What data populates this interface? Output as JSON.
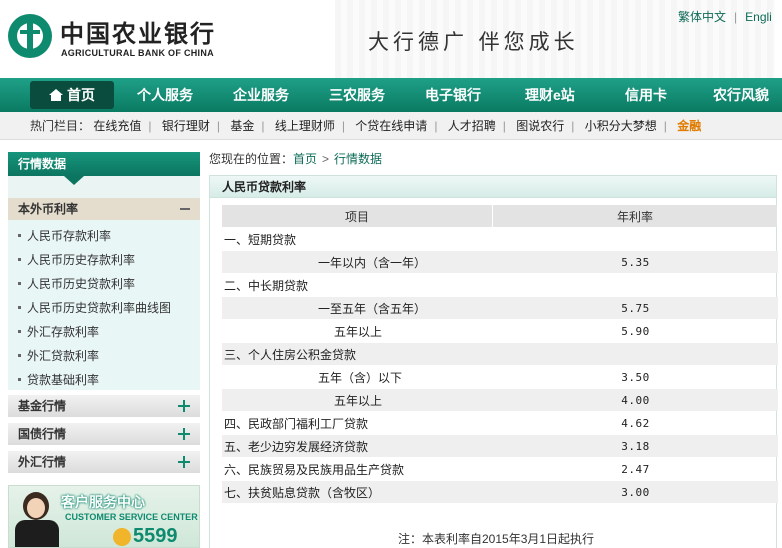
{
  "header": {
    "bank_name_cn": "中国农业银行",
    "bank_name_en": "AGRICULTURAL BANK OF CHINA",
    "slogan": "大行德广  伴您成长",
    "lang_traditional": "繁体中文",
    "lang_separator": "|",
    "lang_english": "Engli"
  },
  "nav": {
    "home": "首页",
    "items": [
      "个人服务",
      "企业服务",
      "三农服务",
      "电子银行",
      "理财e站",
      "信用卡",
      "农行风貌"
    ]
  },
  "hotbar": {
    "label": "热门栏目：",
    "links": [
      "在线充值",
      "银行理财",
      "基金",
      "线上理财师",
      "个贷在线申请",
      "人才招聘",
      "图说农行",
      "小积分大梦想"
    ],
    "highlight": "金融"
  },
  "sidebar": {
    "title": "行情数据",
    "open_category": "本外币利率",
    "items": [
      "人民币存款利率",
      "人民币历史存款利率",
      "人民币历史贷款利率",
      "人民币历史贷款利率曲线图",
      "外汇存款利率",
      "外汇贷款利率",
      "贷款基础利率"
    ],
    "categories": [
      "基金行情",
      "国债行情",
      "外汇行情"
    ],
    "banner": {
      "title": "客户服务中心",
      "subtitle": "CUSTOMER SERVICE CENTER",
      "number": "5599"
    }
  },
  "breadcrumb": {
    "prefix": "您现在的位置：",
    "home": "首页",
    "current": "行情数据"
  },
  "panel": {
    "title": "人民币贷款利率",
    "columns": [
      "项目",
      "年利率"
    ],
    "rows": [
      {
        "item": "一、短期贷款",
        "rate": ""
      },
      {
        "item": "一年以内（含一年）",
        "rate": "5.35"
      },
      {
        "item": "二、中长期贷款",
        "rate": ""
      },
      {
        "item": "一至五年（含五年）",
        "rate": "5.75"
      },
      {
        "item": "五年以上",
        "rate": "5.90"
      },
      {
        "item": "三、个人住房公积金贷款",
        "rate": ""
      },
      {
        "item": "五年（含）以下",
        "rate": "3.50"
      },
      {
        "item": "五年以上",
        "rate": "4.00"
      },
      {
        "item": "四、民政部门福利工厂贷款",
        "rate": "4.62"
      },
      {
        "item": "五、老少边穷发展经济贷款",
        "rate": "3.18"
      },
      {
        "item": "六、民族贸易及民族用品生产贷款",
        "rate": "2.47"
      },
      {
        "item": "七、扶贫贴息贷款（含牧区）",
        "rate": "3.00"
      }
    ],
    "note": "注：本表利率自2015年3月1日起执行"
  }
}
